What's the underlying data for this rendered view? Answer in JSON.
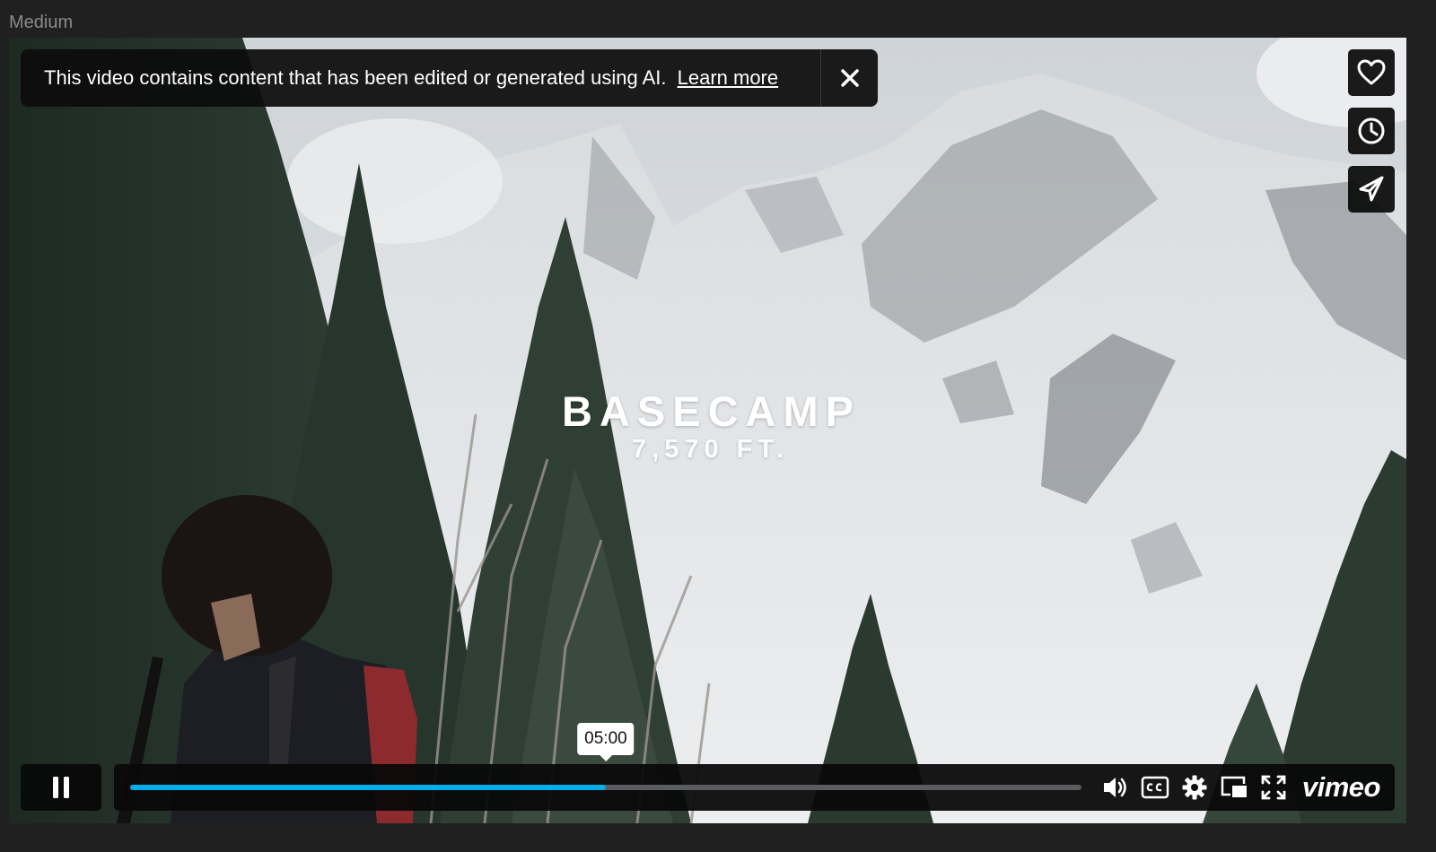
{
  "size_label": "Medium",
  "ai_notice": {
    "text": "This video contains content that has been edited or generated using AI.",
    "link": "Learn more"
  },
  "video": {
    "title": "BASECAMP",
    "subtitle": "7,570 FT."
  },
  "side_actions": [
    {
      "name": "like",
      "icon": "heart-icon"
    },
    {
      "name": "watch-later",
      "icon": "clock-icon"
    },
    {
      "name": "share",
      "icon": "paper-plane-icon"
    }
  ],
  "player": {
    "state": "playing",
    "hover_time": "05:00",
    "progress_fraction": 0.5,
    "brand": "vimeo",
    "accent_color": "#00adef",
    "controls": [
      "pause-icon",
      "volume-icon",
      "captions-icon",
      "settings-icon",
      "picture-in-picture-icon",
      "fullscreen-icon"
    ]
  }
}
